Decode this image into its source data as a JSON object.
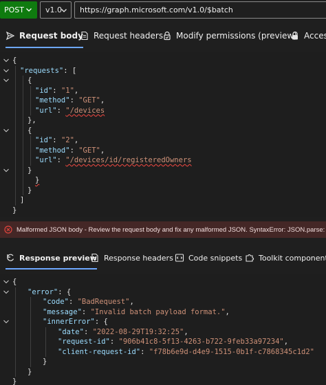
{
  "toolbar": {
    "method": "POST",
    "version": "v1.0",
    "url": "https://graph.microsoft.com/v1.0/$batch"
  },
  "request_tabs": [
    {
      "label": "Request body",
      "icon": "send-icon",
      "active": true
    },
    {
      "label": "Request headers",
      "icon": "document-icon",
      "active": false
    },
    {
      "label": "Modify permissions (preview)",
      "icon": "lock-check-icon",
      "active": false
    },
    {
      "label": "Access",
      "icon": "lock-icon",
      "active": false
    }
  ],
  "request_body": [
    {
      "fold": true,
      "parts": [
        [
          "p",
          "{"
        ]
      ]
    },
    {
      "fold": true,
      "parts": [
        [
          "k",
          "\"requests\""
        ],
        [
          "p",
          ": ["
        ]
      ]
    },
    {
      "fold": true,
      "parts": [
        [
          "p",
          "{"
        ]
      ]
    },
    {
      "fold": false,
      "parts": [
        [
          "k",
          "\"id\""
        ],
        [
          "p",
          ": "
        ],
        [
          "s",
          "\"1\""
        ],
        [
          "p",
          ","
        ]
      ]
    },
    {
      "fold": false,
      "parts": [
        [
          "k",
          "\"method\""
        ],
        [
          "p",
          ": "
        ],
        [
          "s",
          "\"GET\""
        ],
        [
          "p",
          ","
        ]
      ]
    },
    {
      "fold": false,
      "parts": [
        [
          "k",
          "\"url\""
        ],
        [
          "p",
          ": "
        ],
        [
          "s",
          "\"/devices"
        ]
      ]
    },
    {
      "fold": false,
      "parts": [
        [
          "p",
          "},"
        ]
      ]
    },
    {
      "fold": true,
      "parts": [
        [
          "p",
          "{"
        ]
      ]
    },
    {
      "fold": false,
      "parts": [
        [
          "k",
          "\"id\""
        ],
        [
          "p",
          ": "
        ],
        [
          "s",
          "\"2\""
        ],
        [
          "p",
          ","
        ]
      ]
    },
    {
      "fold": false,
      "parts": [
        [
          "k",
          "\"method\""
        ],
        [
          "p",
          ": "
        ],
        [
          "s",
          "\"GET\""
        ],
        [
          "p",
          ","
        ]
      ]
    },
    {
      "fold": false,
      "parts": [
        [
          "k",
          "\"url\""
        ],
        [
          "p",
          ": "
        ],
        [
          "s",
          "\"/devices/id/registeredOwners"
        ]
      ]
    },
    {
      "fold": true,
      "parts": [
        [
          "p",
          "}"
        ]
      ]
    },
    {
      "fold": false,
      "parts": [
        [
          "p",
          "}"
        ]
      ]
    },
    {
      "fold": false,
      "parts": [
        [
          "p",
          "}"
        ]
      ]
    },
    {
      "fold": false,
      "parts": [
        [
          "p",
          "]"
        ]
      ]
    },
    {
      "fold": false,
      "parts": [
        [
          "p",
          "}"
        ]
      ]
    }
  ],
  "error": {
    "icon": "error-circle-icon",
    "color": "#e0453e",
    "message": "Malformed JSON body - Review the request body and fix any malformed JSON. SyntaxError: JSON.parse: bad control"
  },
  "response_tabs": [
    {
      "label": "Response preview",
      "icon": "response-icon",
      "active": true
    },
    {
      "label": "Response headers",
      "icon": "document-icon",
      "active": false
    },
    {
      "label": "Code snippets",
      "icon": "code-snippet-icon",
      "active": false
    },
    {
      "label": "Toolkit component",
      "icon": "puzzle-icon",
      "active": false
    }
  ],
  "response_body": [
    {
      "fold": true,
      "parts": [
        [
          "p",
          "{"
        ]
      ]
    },
    {
      "fold": true,
      "parts": [
        [
          "k",
          "\"error\""
        ],
        [
          "p",
          ": {"
        ]
      ]
    },
    {
      "fold": false,
      "parts": [
        [
          "k",
          "\"code\""
        ],
        [
          "p",
          ": "
        ],
        [
          "s",
          "\"BadRequest\""
        ],
        [
          "p",
          ","
        ]
      ]
    },
    {
      "fold": false,
      "parts": [
        [
          "k",
          "\"message\""
        ],
        [
          "p",
          ": "
        ],
        [
          "s",
          "\"Invalid batch payload format.\""
        ],
        [
          "p",
          ","
        ]
      ]
    },
    {
      "fold": true,
      "parts": [
        [
          "k",
          "\"innerError\""
        ],
        [
          "p",
          ": {"
        ]
      ]
    },
    {
      "fold": false,
      "parts": [
        [
          "k",
          "\"date\""
        ],
        [
          "p",
          ": "
        ],
        [
          "s",
          "\"2022-08-29T19:32:25\""
        ],
        [
          "p",
          ","
        ]
      ]
    },
    {
      "fold": false,
      "parts": [
        [
          "k",
          "\"request-id\""
        ],
        [
          "p",
          ": "
        ],
        [
          "s",
          "\"906b41c8-5f13-4263-b722-9feb33a97234\""
        ],
        [
          "p",
          ","
        ]
      ]
    },
    {
      "fold": false,
      "parts": [
        [
          "k",
          "\"client-request-id\""
        ],
        [
          "p",
          ": "
        ],
        [
          "s",
          "\"f78b6e9d-d4e9-1515-0b1f-c7868345c1d2\""
        ]
      ]
    },
    {
      "fold": false,
      "parts": [
        [
          "p",
          "}"
        ]
      ]
    },
    {
      "fold": false,
      "parts": [
        [
          "p",
          "}"
        ]
      ]
    },
    {
      "fold": false,
      "parts": [
        [
          "p",
          "}"
        ]
      ]
    }
  ]
}
